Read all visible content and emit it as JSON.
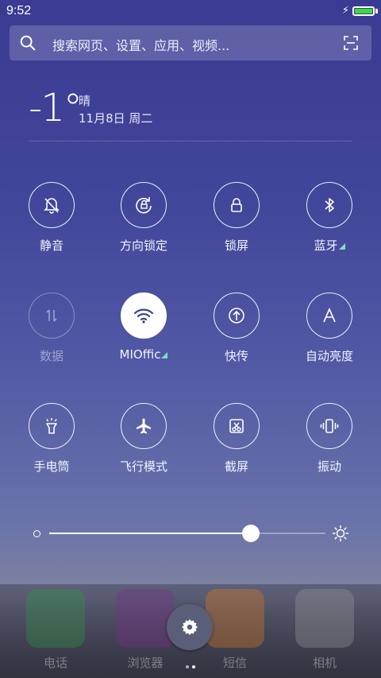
{
  "status": {
    "time": "9:52",
    "battery_level": 1.0
  },
  "search": {
    "placeholder": "搜索网页、设置、应用、视频..."
  },
  "weather": {
    "temperature": "-1°",
    "condition": "晴",
    "date": "11月8日 周二"
  },
  "toggles": [
    {
      "label": "静音",
      "icon": "bell-off-icon",
      "state": "off"
    },
    {
      "label": "方向锁定",
      "icon": "rotation-lock-icon",
      "state": "off"
    },
    {
      "label": "锁屏",
      "icon": "lock-icon",
      "state": "off"
    },
    {
      "label": "蓝牙",
      "icon": "bluetooth-icon",
      "state": "off",
      "has_menu": true
    },
    {
      "label": "数据",
      "icon": "data-arrows-icon",
      "state": "disabled"
    },
    {
      "label": "MIOffic",
      "icon": "wifi-icon",
      "state": "on",
      "has_menu": true
    },
    {
      "label": "快传",
      "icon": "share-upload-icon",
      "state": "off"
    },
    {
      "label": "自动亮度",
      "icon": "auto-brightness-icon",
      "state": "off"
    },
    {
      "label": "手电筒",
      "icon": "flashlight-icon",
      "state": "off"
    },
    {
      "label": "飞行模式",
      "icon": "airplane-icon",
      "state": "off"
    },
    {
      "label": "截屏",
      "icon": "screenshot-icon",
      "state": "off"
    },
    {
      "label": "振动",
      "icon": "vibrate-icon",
      "state": "off"
    }
  ],
  "brightness": {
    "level": 0.73
  },
  "dock": {
    "apps": [
      {
        "label": "电话",
        "color": "#2e9b3f"
      },
      {
        "label": "浏览器",
        "color": "#7a2f8a"
      },
      {
        "label": "短信",
        "color": "#e07a1a"
      },
      {
        "label": "相机",
        "color": "#9a9a9a"
      }
    ],
    "page_count": 2,
    "current_page": 2
  }
}
